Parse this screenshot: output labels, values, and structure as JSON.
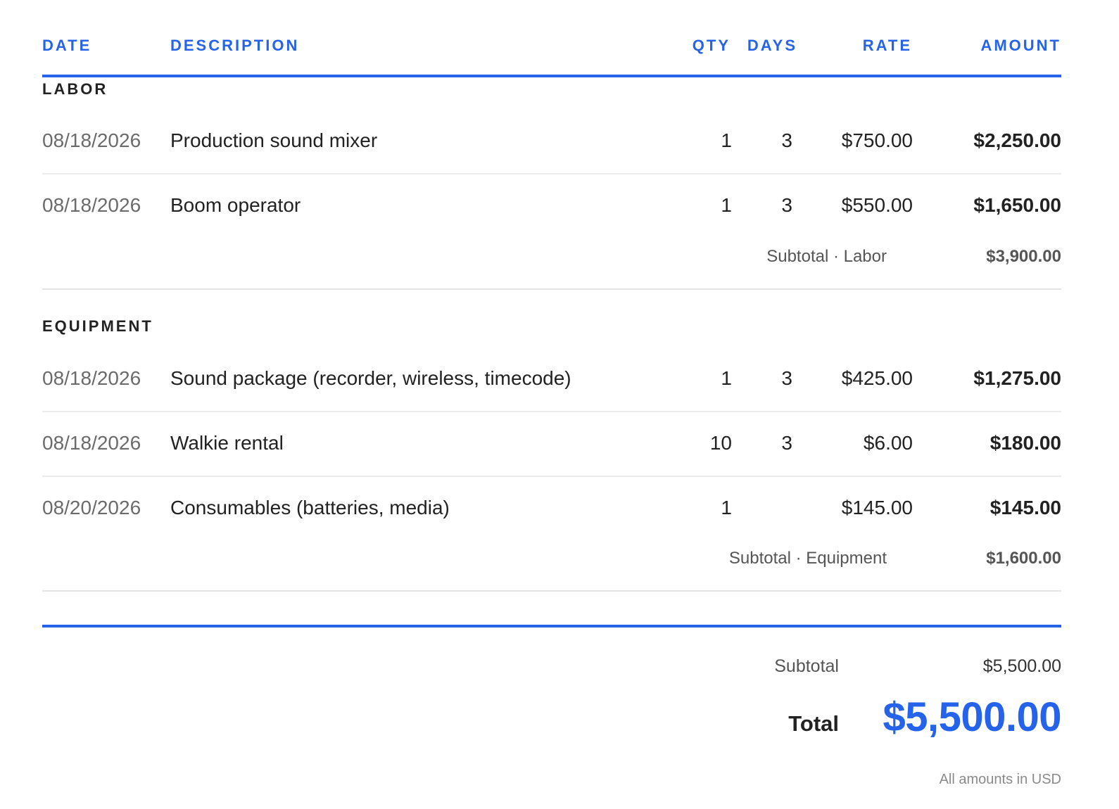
{
  "columns": {
    "date": "DATE",
    "description": "DESCRIPTION",
    "qty": "QTY",
    "days": "DAYS",
    "rate": "RATE",
    "amount": "AMOUNT"
  },
  "sections": [
    {
      "title": "LABOR",
      "rows": [
        {
          "date": "08/18/2026",
          "description": "Production sound mixer",
          "qty": "1",
          "days": "3",
          "rate": "$750.00",
          "amount": "$2,250.00"
        },
        {
          "date": "08/18/2026",
          "description": "Boom operator",
          "qty": "1",
          "days": "3",
          "rate": "$550.00",
          "amount": "$1,650.00"
        }
      ],
      "subtotal_label": "Subtotal · Labor",
      "subtotal_value": "$3,900.00"
    },
    {
      "title": "EQUIPMENT",
      "rows": [
        {
          "date": "08/18/2026",
          "description": "Sound package (recorder, wireless, timecode)",
          "qty": "1",
          "days": "3",
          "rate": "$425.00",
          "amount": "$1,275.00"
        },
        {
          "date": "08/18/2026",
          "description": "Walkie rental",
          "qty": "10",
          "days": "3",
          "rate": "$6.00",
          "amount": "$180.00"
        },
        {
          "date": "08/20/2026",
          "description": "Consumables (batteries, media)",
          "qty": "1",
          "days": "",
          "rate": "$145.00",
          "amount": "$145.00"
        }
      ],
      "subtotal_label": "Subtotal · Equipment",
      "subtotal_value": "$1,600.00"
    }
  ],
  "summary": {
    "subtotal_label": "Subtotal",
    "subtotal_value": "$5,500.00",
    "total_label": "Total",
    "total_value": "$5,500.00",
    "footnote": "All amounts in USD"
  },
  "colors": {
    "accent": "#2563eb",
    "text": "#222222",
    "muted": "#6b6b6b"
  }
}
